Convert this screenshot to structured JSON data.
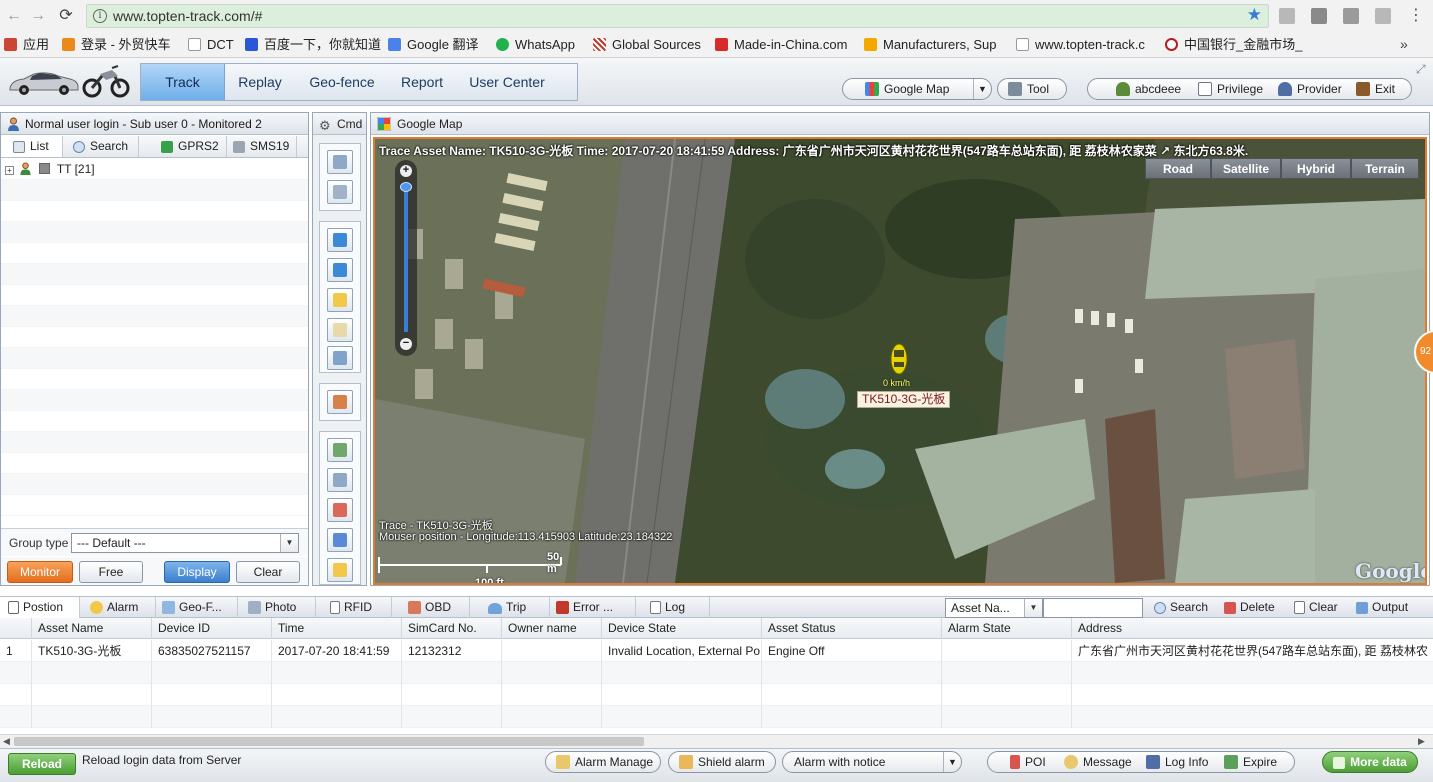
{
  "browser": {
    "url": "www.topten-track.com/#",
    "bookmarks": [
      {
        "label": "应用",
        "icon": "apps-grid-icon",
        "color": "#c43"
      },
      {
        "label": "登录 - 外贸快车",
        "icon": "bird-icon",
        "color": "#e98a1b"
      },
      {
        "label": "DCT",
        "icon": "page-icon",
        "color": "#ddd"
      },
      {
        "label": "百度一下，你就知道",
        "icon": "paw-icon",
        "color": "#2a57d8"
      },
      {
        "label": "Google 翻译",
        "icon": "translate-icon",
        "color": "#4a82ea"
      },
      {
        "label": "WhatsApp",
        "icon": "whatsapp-icon",
        "color": "#22b14c"
      },
      {
        "label": "Global Sources",
        "icon": "stripes-icon",
        "color": "#c0392b"
      },
      {
        "label": "Made-in-China.com",
        "icon": "mic-icon",
        "color": "#d72b2b"
      },
      {
        "label": "Manufacturers, Sup",
        "icon": "flag-icon",
        "color": "#f5a800"
      },
      {
        "label": "www.topten-track.c",
        "icon": "page-icon",
        "color": "#ddd"
      },
      {
        "label": "中国银行_金融市场_",
        "icon": "boc-icon",
        "color": "#b71c1c"
      }
    ],
    "more_symbol": "»"
  },
  "header": {
    "tabs": [
      {
        "label": "Track",
        "active": true
      },
      {
        "label": "Replay",
        "active": false
      },
      {
        "label": "Geo-fence",
        "active": false
      },
      {
        "label": "Report",
        "active": false
      },
      {
        "label": "User Center",
        "active": false
      }
    ],
    "map_select": "Google Map",
    "tool": "Tool",
    "user": "abcdeee",
    "privilege": "Privilege",
    "provider": "Provider",
    "exit": "Exit"
  },
  "left": {
    "title": "Normal user login - Sub user 0 - Monitored 2",
    "tabs": {
      "list": "List",
      "search": "Search",
      "gprs": "GPRS2",
      "sms": "SMS19"
    },
    "tree_item": "TT [21]",
    "group_type_label": "Group type",
    "group_type_value": "--- Default ---",
    "buttons": {
      "monitor": "Monitor",
      "free": "Free",
      "display": "Display",
      "clear": "Clear"
    }
  },
  "cmd": {
    "title": "Cmd"
  },
  "map": {
    "title": "Google Map",
    "trace_info": "Trace Asset Name: TK510-3G-光板  Time: 2017-07-20 18:41:59  Address: 广东省广州市天河区黄村花花世界(547路车总站东面), 距 荔枝林农家菜 ↗ 东北方63.8米.",
    "map_types": [
      "Road",
      "Satellite",
      "Hybrid",
      "Terrain"
    ],
    "active_map_type": "Satellite",
    "vehicle_label": "TK510-3G-光板",
    "vehicle_speed": "0 km/h",
    "trace_line": "Trace - TK510-3G-光板",
    "mouse_line": "Mouser position - Longitude:113.415903 Latitude:23.184322",
    "scale_m": "50 m",
    "scale_ft": "100 ft",
    "google": "Google",
    "side_tab": "92"
  },
  "bottom": {
    "tabs": [
      "Postion",
      "Alarm",
      "Geo-F...",
      "Photo",
      "RFID",
      "OBD",
      "Trip",
      "Error ...",
      "Log"
    ],
    "filter_select": "Asset Na...",
    "filter_value": "",
    "actions": {
      "search": "Search",
      "delete": "Delete",
      "clear": "Clear",
      "output": "Output"
    },
    "columns": [
      "Asset Name",
      "Device ID",
      "Time",
      "SimCard No.",
      "Owner name",
      "Device State",
      "Asset Status",
      "Alarm State",
      "Address"
    ],
    "rows": [
      {
        "index": "1",
        "asset_name": "TK510-3G-光板",
        "device_id": "63835027521157",
        "time": "2017-07-20 18:41:59",
        "simcard": "12132312",
        "owner": "",
        "device_state": "Invalid Location, External Po",
        "asset_status": "Engine Off",
        "alarm_state": "",
        "address": "广东省广州市天河区黄村花花世界(547路车总站东面), 距 荔枝林农"
      }
    ]
  },
  "status": {
    "reload": "Reload",
    "reload_msg": "Reload login data from Server",
    "alarm_manage": "Alarm Manage",
    "shield_alarm": "Shield alarm",
    "alarm_notice": "Alarm with notice",
    "poi": "POI",
    "message": "Message",
    "log_info": "Log Info",
    "expire": "Expire",
    "more_data": "More data"
  },
  "colors": {
    "accent_orange": "#e07b2e",
    "tab_blue": "#6eaee9",
    "ok_green": "#4c9e35"
  }
}
